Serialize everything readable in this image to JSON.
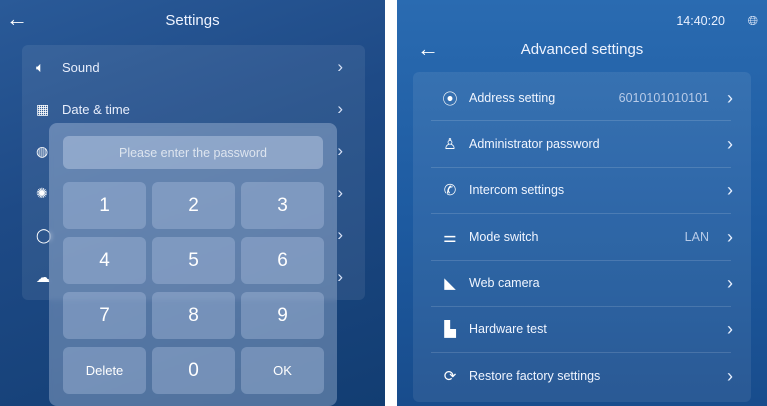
{
  "left": {
    "title": "Settings",
    "back_icon": "arrow-left-icon",
    "rows": [
      {
        "icon": "speaker-icon",
        "label": "Sound"
      },
      {
        "icon": "calendar-icon",
        "label": "Date & time"
      },
      {
        "icon": "globe-icon",
        "label": ""
      },
      {
        "icon": "brightness-icon",
        "label": ""
      },
      {
        "icon": "clock-icon",
        "label": ""
      },
      {
        "icon": "cloud-icon",
        "label": ""
      }
    ],
    "keypad": {
      "placeholder": "Please enter the password",
      "keys": [
        "1",
        "2",
        "3",
        "4",
        "5",
        "6",
        "7",
        "8",
        "9",
        "Delete",
        "0",
        "OK"
      ]
    }
  },
  "right": {
    "title": "Advanced settings",
    "time": "14:40:20",
    "rows": [
      {
        "icon": "location-pin-icon",
        "label": "Address setting",
        "value": "6010101010101"
      },
      {
        "icon": "admin-key-icon",
        "label": "Administrator password",
        "value": ""
      },
      {
        "icon": "intercom-phone-icon",
        "label": "Intercom settings",
        "value": ""
      },
      {
        "icon": "mode-switch-icon",
        "label": "Mode switch",
        "value": "LAN"
      },
      {
        "icon": "web-camera-icon",
        "label": "Web camera",
        "value": ""
      },
      {
        "icon": "hardware-test-icon",
        "label": "Hardware test",
        "value": ""
      },
      {
        "icon": "restore-icon",
        "label": "Restore factory settings",
        "value": ""
      }
    ]
  }
}
